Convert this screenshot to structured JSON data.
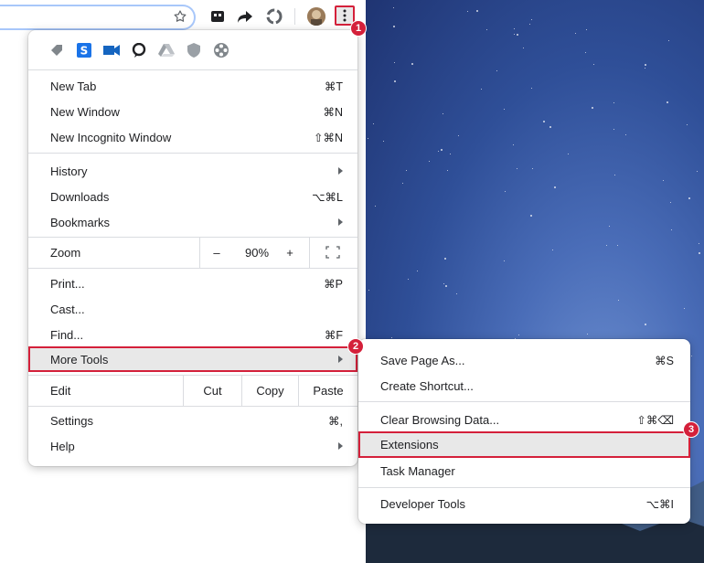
{
  "badges": [
    "1",
    "2",
    "3"
  ],
  "menu": {
    "new_tab": {
      "label": "New Tab",
      "shortcut": "⌘T"
    },
    "new_window": {
      "label": "New Window",
      "shortcut": "⌘N"
    },
    "new_incognito": {
      "label": "New Incognito Window",
      "shortcut": "⇧⌘N"
    },
    "history": {
      "label": "History"
    },
    "downloads": {
      "label": "Downloads",
      "shortcut": "⌥⌘L"
    },
    "bookmarks": {
      "label": "Bookmarks"
    },
    "zoom": {
      "label": "Zoom",
      "minus": "–",
      "value": "90%",
      "plus": "+"
    },
    "print": {
      "label": "Print...",
      "shortcut": "⌘P"
    },
    "cast": {
      "label": "Cast..."
    },
    "find": {
      "label": "Find...",
      "shortcut": "⌘F"
    },
    "more_tools": {
      "label": "More Tools"
    },
    "edit": {
      "label": "Edit",
      "cut": "Cut",
      "copy": "Copy",
      "paste": "Paste"
    },
    "settings": {
      "label": "Settings",
      "shortcut": "⌘,"
    },
    "help": {
      "label": "Help"
    }
  },
  "submenu": {
    "save_page": {
      "label": "Save Page As...",
      "shortcut": "⌘S"
    },
    "create_shortcut": {
      "label": "Create Shortcut..."
    },
    "clear_data": {
      "label": "Clear Browsing Data...",
      "shortcut": "⇧⌘⌫"
    },
    "extensions": {
      "label": "Extensions"
    },
    "task_manager": {
      "label": "Task Manager"
    },
    "dev_tools": {
      "label": "Developer Tools",
      "shortcut": "⌥⌘I"
    }
  },
  "icons": {
    "toolbar": [
      "star-icon",
      "tab-manager-icon",
      "share-arrow-icon",
      "recycle-icon",
      "profile-avatar",
      "kebab-menu-icon"
    ],
    "extensions": [
      "tag-icon",
      "s-extension-icon",
      "video-icon",
      "chat-icon",
      "drive-icon",
      "shield-icon",
      "film-reel-icon"
    ]
  },
  "colors": {
    "highlight_border": "#d4203a",
    "badge": "#d4203a",
    "hover_bg": "#e8e8e8",
    "s_ext": "#1a73e8",
    "video_ext": "#1565c0"
  }
}
